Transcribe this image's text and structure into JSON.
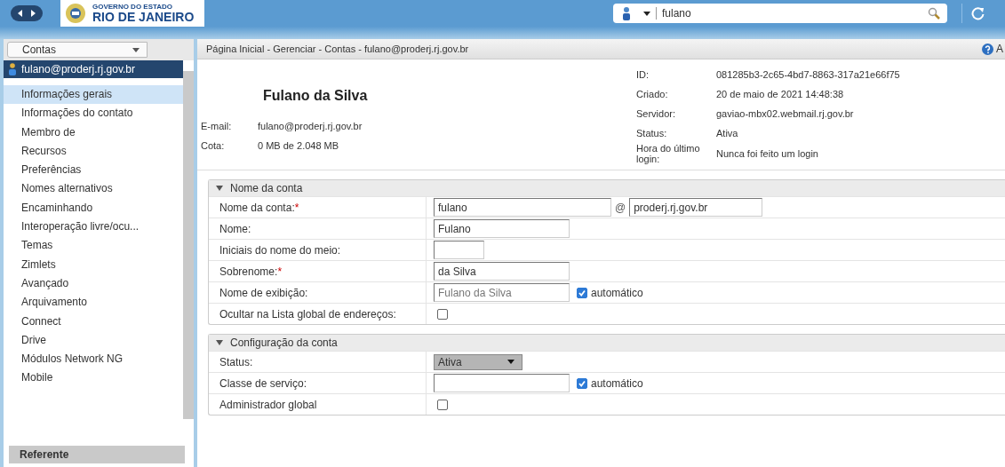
{
  "header": {
    "logo": {
      "small": "GOVERNO DO ESTADO",
      "big": "RIO DE JANEIRO"
    },
    "search": {
      "value": "fulano"
    }
  },
  "sidebar": {
    "dropdown": "Contas",
    "account": {
      "label": "fulano@proderj.rj.gov.br",
      "selected": true
    },
    "items": [
      {
        "label": "Informações gerais",
        "selected": true
      },
      {
        "label": "Informações do contato",
        "selected": false
      },
      {
        "label": "Membro de",
        "selected": false
      },
      {
        "label": "Recursos",
        "selected": false
      },
      {
        "label": "Preferências",
        "selected": false
      },
      {
        "label": "Nomes alternativos",
        "selected": false
      },
      {
        "label": "Encaminhando",
        "selected": false
      },
      {
        "label": "Interoperação livre/ocu...",
        "selected": false
      },
      {
        "label": "Temas",
        "selected": false
      },
      {
        "label": "Zimlets",
        "selected": false
      },
      {
        "label": "Avançado",
        "selected": false
      },
      {
        "label": "Arquivamento",
        "selected": false
      },
      {
        "label": "Connect",
        "selected": false
      },
      {
        "label": "Drive",
        "selected": false
      },
      {
        "label": "Módulos Network NG",
        "selected": false
      },
      {
        "label": "Mobile",
        "selected": false
      }
    ],
    "footer": "Referente"
  },
  "breadcrumb": "Página Inicial - Gerenciar - Contas - fulano@proderj.rj.gov.br",
  "help": "A",
  "summary": {
    "name": "Fulano da Silva",
    "left": [
      {
        "label": "E-mail:",
        "value": "fulano@proderj.rj.gov.br"
      },
      {
        "label": "Cota:",
        "value": "0 MB de 2.048 MB"
      }
    ],
    "right": [
      {
        "label": "ID:",
        "value": "081285b3-2c65-4bd7-8863-317a21e66f75"
      },
      {
        "label": "Criado:",
        "value": "20 de maio de 2021 14:48:38"
      },
      {
        "label": "Servidor:",
        "value": "gaviao-mbx02.webmail.rj.gov.br"
      },
      {
        "label": "Status:",
        "value": "Ativa"
      },
      {
        "label": "Hora do último login:",
        "value": "Nunca foi feito um login"
      }
    ]
  },
  "sections": [
    {
      "title": "Nome da conta",
      "expanded": true,
      "rows": [
        {
          "kind": "email",
          "label": "Nome da conta:",
          "required_mark": "*",
          "value": "fulano",
          "at": "@",
          "domain": "proderj.rj.gov.br"
        },
        {
          "kind": "text",
          "label": "Nome:",
          "value": "Fulano"
        },
        {
          "kind": "short",
          "label": "Iniciais do nome do meio:"
        },
        {
          "kind": "text",
          "label": "Sobrenome:",
          "required_mark": "*",
          "value": "da Silva"
        },
        {
          "kind": "auto",
          "label": "Nome de exibição:",
          "value": "Fulano da Silva",
          "auto_label": "automático",
          "auto": true
        },
        {
          "kind": "checkbox",
          "label": "Ocultar na Lista global de endereços:",
          "checked": false
        }
      ]
    },
    {
      "title": "Configuração da conta",
      "expanded": true,
      "rows": [
        {
          "kind": "select",
          "label": "Status:",
          "value": "Ativa"
        },
        {
          "kind": "auto",
          "label": "Classe de serviço:",
          "auto_label": "automático",
          "auto": true
        },
        {
          "kind": "checkbox",
          "label": "Administrador global",
          "checked": false
        }
      ]
    }
  ]
}
